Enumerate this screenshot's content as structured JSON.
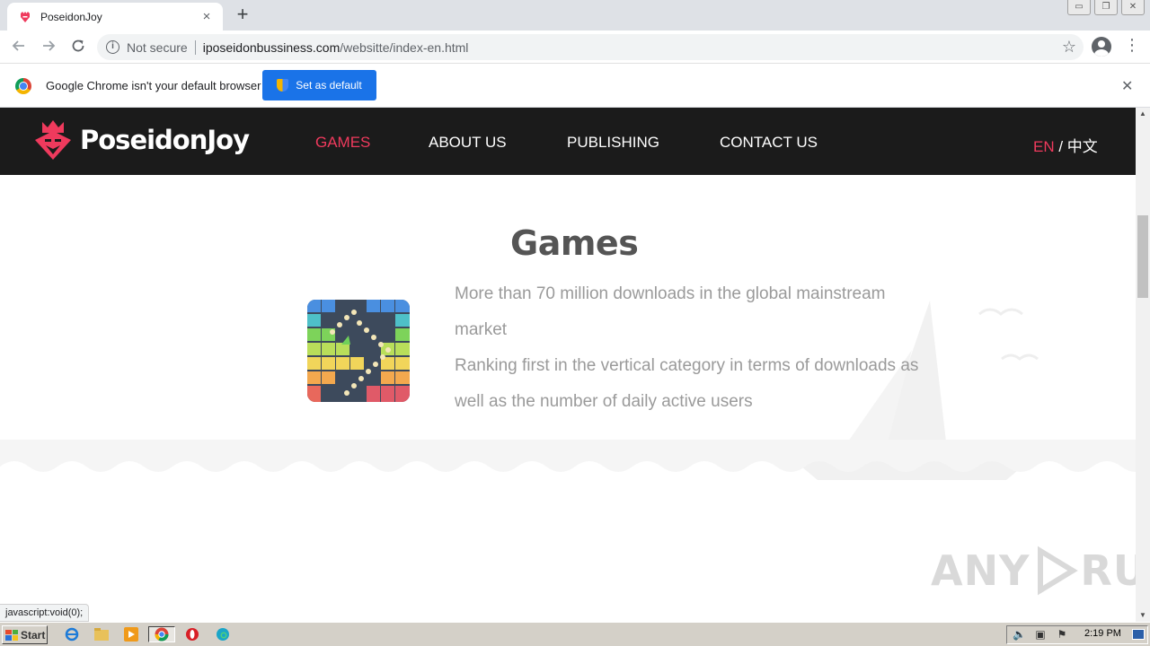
{
  "browser": {
    "tab_title": "PoseidonJoy",
    "new_tab_symbol": "+",
    "tab_close_symbol": "×",
    "window_controls": [
      "▭",
      "❐",
      "✕"
    ],
    "security_label": "Not secure",
    "url_host": "iposeidonbussiness.com",
    "url_path": "/websitte/index-en.html",
    "status_text": "javascript:void(0);"
  },
  "infobar": {
    "message": "Google Chrome isn't your default browser",
    "button_label": "Set as default",
    "close_symbol": "✕"
  },
  "site": {
    "brand": "PoseidonJoy",
    "nav": [
      "GAMES",
      "ABOUT US",
      "PUBLISHING",
      "CONTACT US"
    ],
    "active_nav": "GAMES",
    "lang_en": "EN",
    "lang_sep": " / ",
    "lang_zh": "中文",
    "heading": "Games",
    "description_line1": "More than 70 million downloads in the global mainstream market",
    "description_line2": "Ranking first in the vertical category in terms of downloads as well as the number of daily active users",
    "accent_color": "#ef3a5d",
    "nav_bg": "#1b1b1b"
  },
  "watermark": {
    "text_left": "ANY",
    "text_right": "RUN"
  },
  "taskbar": {
    "start_label": "Start",
    "clock": "2:19 PM"
  }
}
